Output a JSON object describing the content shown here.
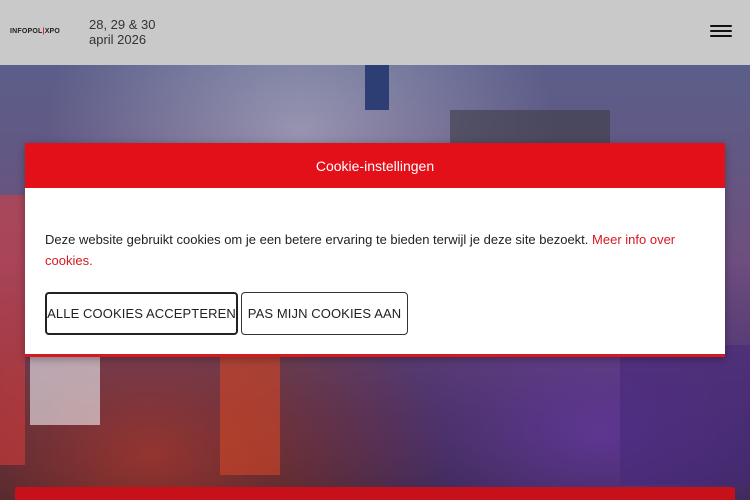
{
  "header": {
    "logo_part1": "INFOPOL",
    "logo_part2": "XPO",
    "dates_line1": "28, 29 & 30",
    "dates_line2": "april 2026"
  },
  "cookie": {
    "title": "Cookie-instellingen",
    "text": "Deze website gebruikt cookies om je een betere ervaring te bieden terwijl je deze site bezoekt. ",
    "link": "Meer info over cookies.",
    "accept_all": "ALLE COOKIES ACCEPTEREN",
    "customize": "PAS MIJN COOKIES AAN"
  },
  "icons": {
    "menu": "hamburger-menu-icon"
  },
  "colors": {
    "accent": "#e3101a",
    "header_bg": "#c9c9c9"
  }
}
